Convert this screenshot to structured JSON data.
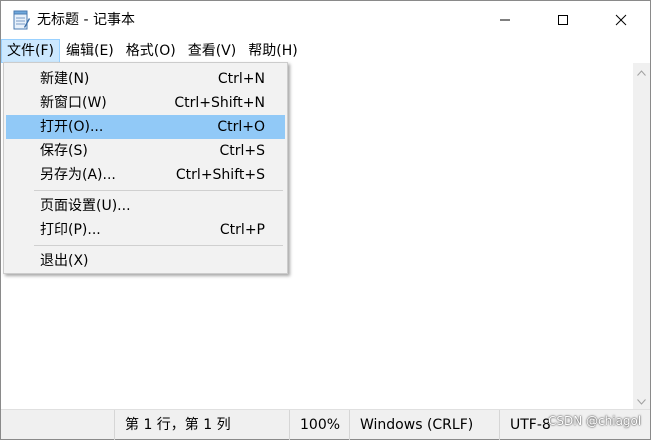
{
  "window": {
    "title": "无标题 - 记事本",
    "icon": "notepad-icon",
    "controls": [
      "minimize-icon",
      "maximize-icon",
      "close-icon"
    ]
  },
  "menubar": {
    "items": [
      {
        "label": "文件(F)",
        "active": true
      },
      {
        "label": "编辑(E)",
        "active": false
      },
      {
        "label": "格式(O)",
        "active": false
      },
      {
        "label": "查看(V)",
        "active": false
      },
      {
        "label": "帮助(H)",
        "active": false
      }
    ]
  },
  "file_menu": {
    "items": [
      {
        "label": "新建(N)",
        "accel": "Ctrl+N"
      },
      {
        "label": "新窗口(W)",
        "accel": "Ctrl+Shift+N"
      },
      {
        "label": "打开(O)...",
        "accel": "Ctrl+O",
        "highlighted": true
      },
      {
        "label": "保存(S)",
        "accel": "Ctrl+S"
      },
      {
        "label": "另存为(A)...",
        "accel": "Ctrl+Shift+S"
      },
      {
        "label": "页面设置(U)...",
        "accel": ""
      },
      {
        "label": "打印(P)...",
        "accel": "Ctrl+P"
      },
      {
        "label": "退出(X)",
        "accel": ""
      }
    ]
  },
  "statusbar": {
    "position": "第 1 行，第 1 列",
    "zoom": "100%",
    "line_ending": "Windows (CRLF)",
    "encoding": "UTF-8"
  },
  "watermark": "CSDN @chiagol",
  "colors": {
    "menu_highlight": "#91c9f7",
    "menubar_active": "#cce8ff",
    "menu_background": "#f2f2f2",
    "statusbar_background": "#f0f0f0"
  }
}
